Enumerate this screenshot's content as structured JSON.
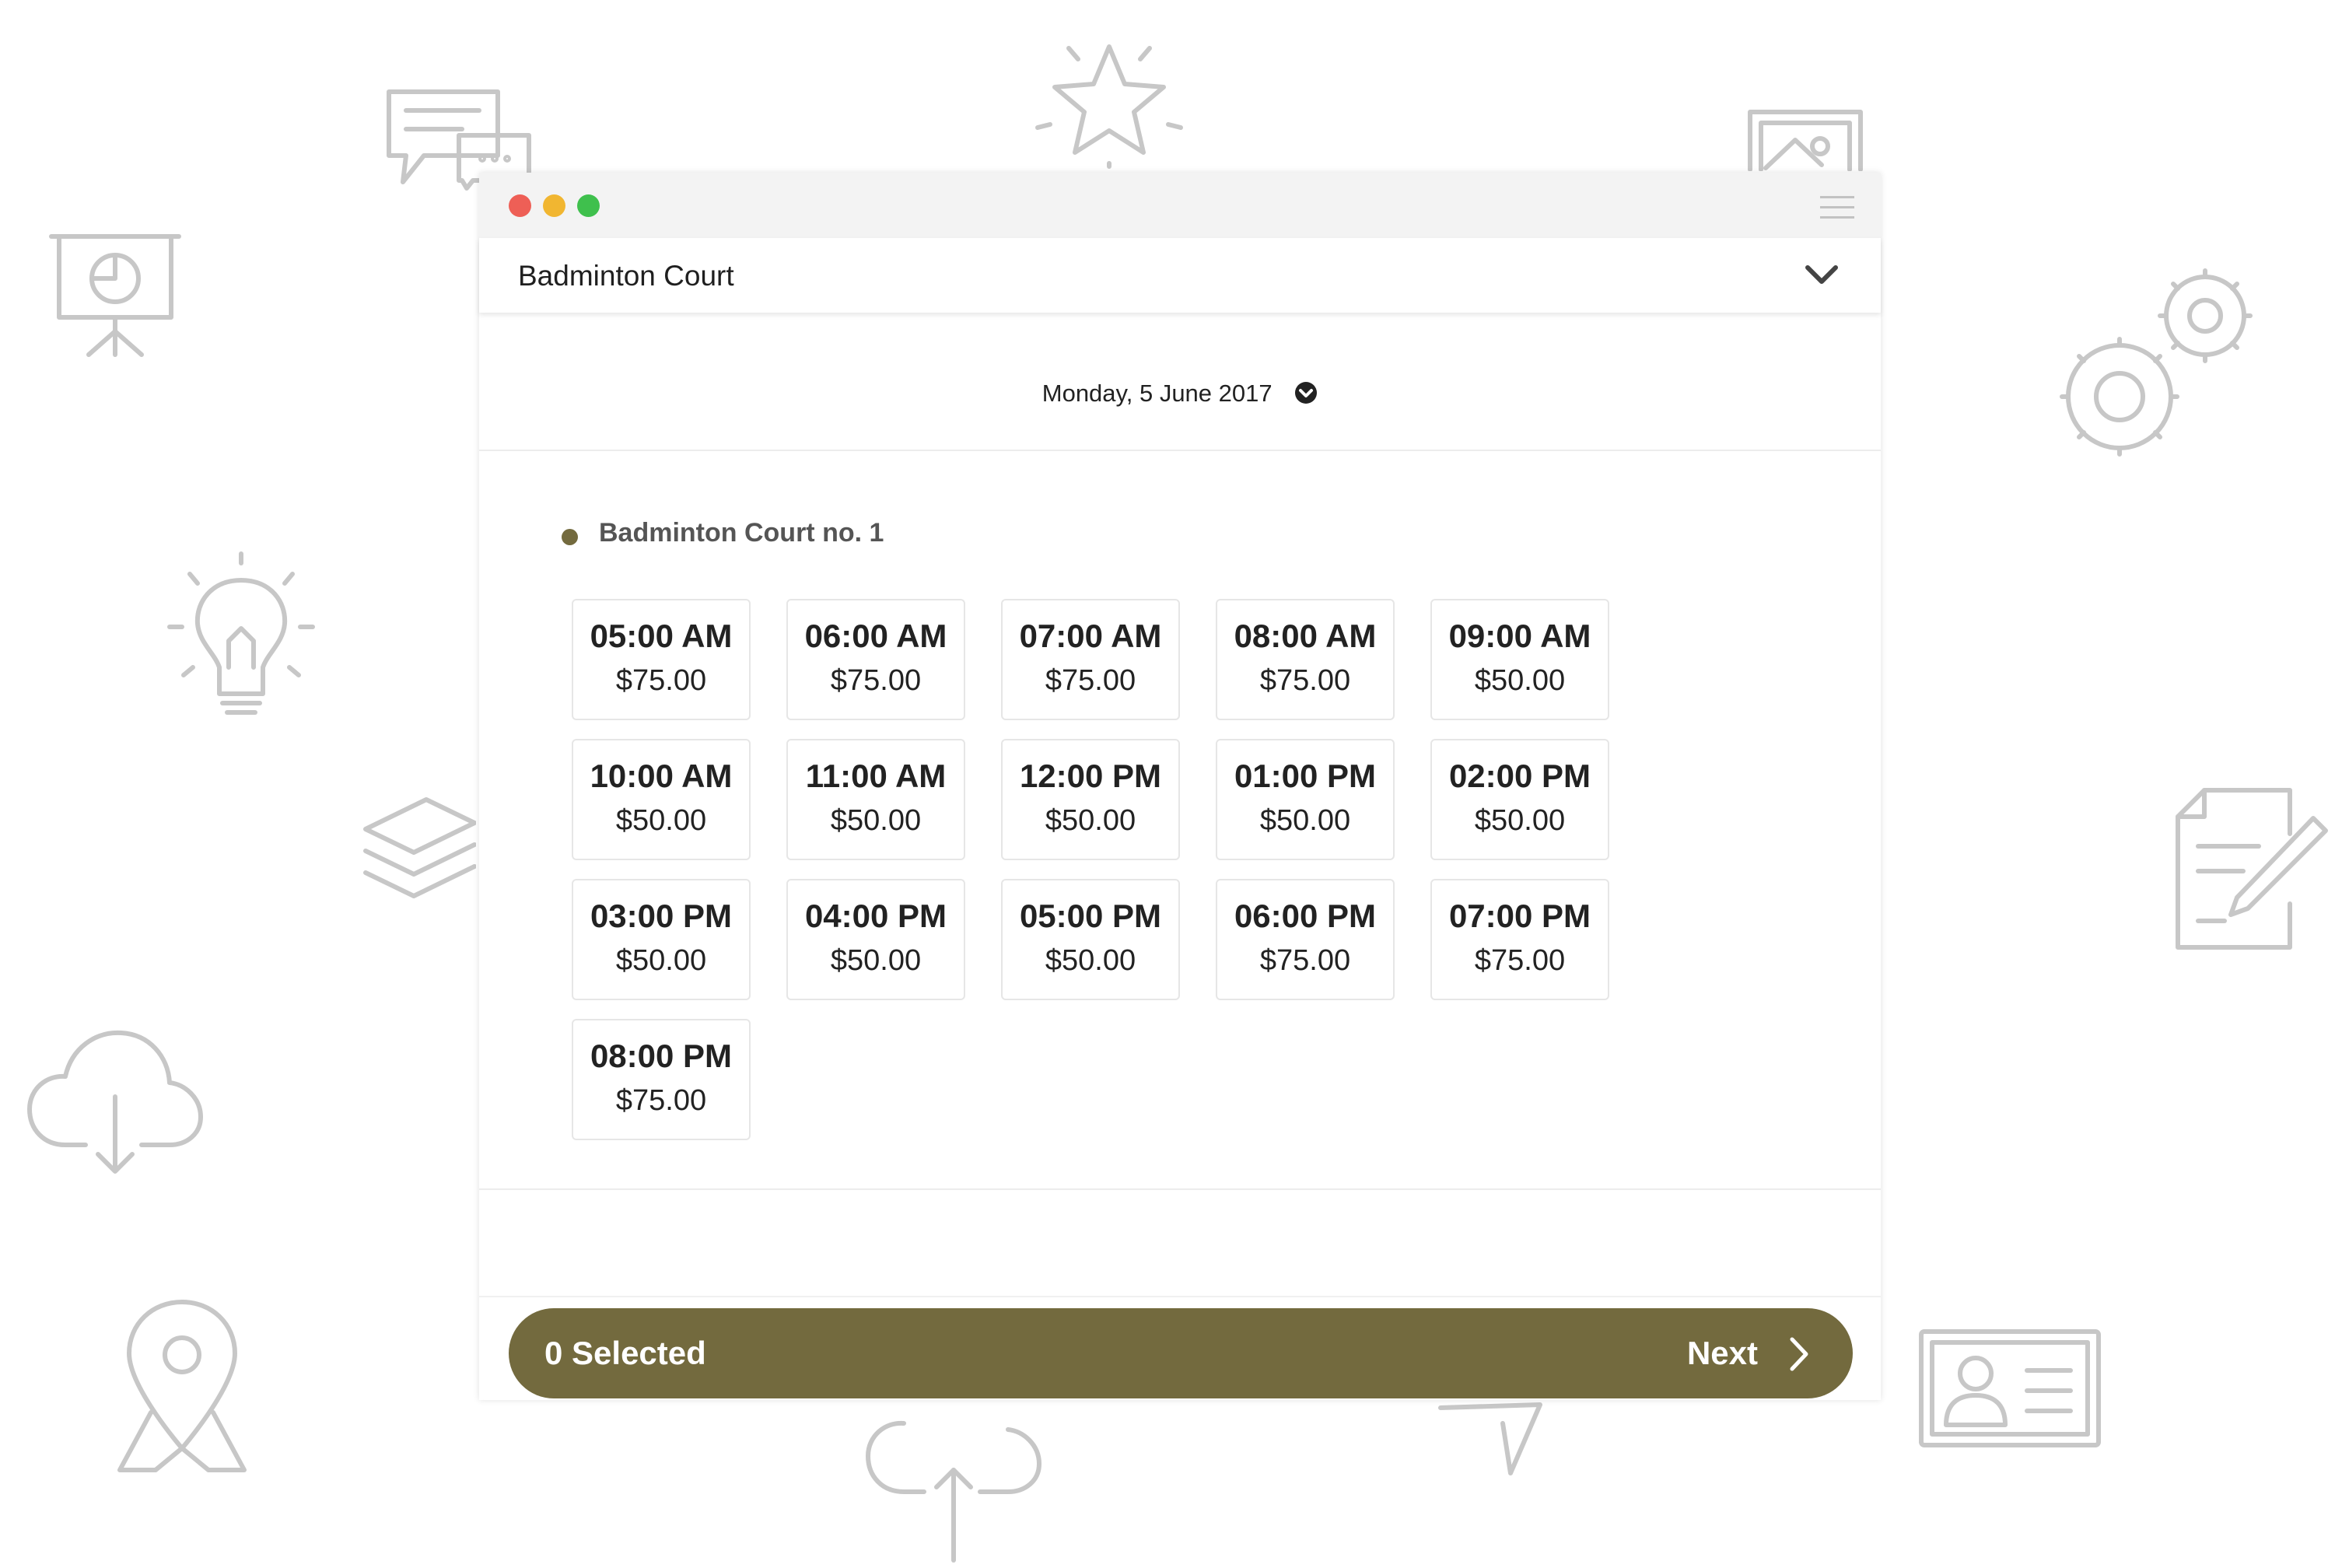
{
  "window": {
    "title_dots": [
      "close",
      "minimize",
      "maximize"
    ]
  },
  "selector": {
    "label": "Badminton Court",
    "icon": "chevron-down-icon"
  },
  "date": {
    "label": "Monday, 5 June 2017",
    "icon": "chevron-circle-down-icon"
  },
  "resource": {
    "name": "Badminton Court no. 1",
    "color": "#736a3e"
  },
  "slots": [
    {
      "time": "05:00 AM",
      "price": "$75.00"
    },
    {
      "time": "06:00 AM",
      "price": "$75.00"
    },
    {
      "time": "07:00 AM",
      "price": "$75.00"
    },
    {
      "time": "08:00 AM",
      "price": "$75.00"
    },
    {
      "time": "09:00 AM",
      "price": "$50.00"
    },
    {
      "time": "10:00 AM",
      "price": "$50.00"
    },
    {
      "time": "11:00 AM",
      "price": "$50.00"
    },
    {
      "time": "12:00 PM",
      "price": "$50.00"
    },
    {
      "time": "01:00 PM",
      "price": "$50.00"
    },
    {
      "time": "02:00 PM",
      "price": "$50.00"
    },
    {
      "time": "03:00 PM",
      "price": "$50.00"
    },
    {
      "time": "04:00 PM",
      "price": "$50.00"
    },
    {
      "time": "05:00 PM",
      "price": "$50.00"
    },
    {
      "time": "06:00 PM",
      "price": "$75.00"
    },
    {
      "time": "07:00 PM",
      "price": "$75.00"
    },
    {
      "time": "08:00 PM",
      "price": "$75.00"
    }
  ],
  "footer": {
    "selected_label": "0 Selected",
    "next_label": "Next",
    "next_icon": "chevron-right-icon"
  },
  "colors": {
    "accent": "#736a3e",
    "close": "#ee5f56",
    "minimize": "#f1b631",
    "maximize": "#3fc04d"
  },
  "background_icons": [
    "chat-icon",
    "star-icon",
    "image-icon",
    "presentation-icon",
    "gears-icon",
    "lightbulb-icon",
    "layers-icon",
    "edit-document-icon",
    "cloud-download-icon",
    "location-pin-icon",
    "cloud-upload-icon",
    "send-icon",
    "contact-card-icon"
  ]
}
